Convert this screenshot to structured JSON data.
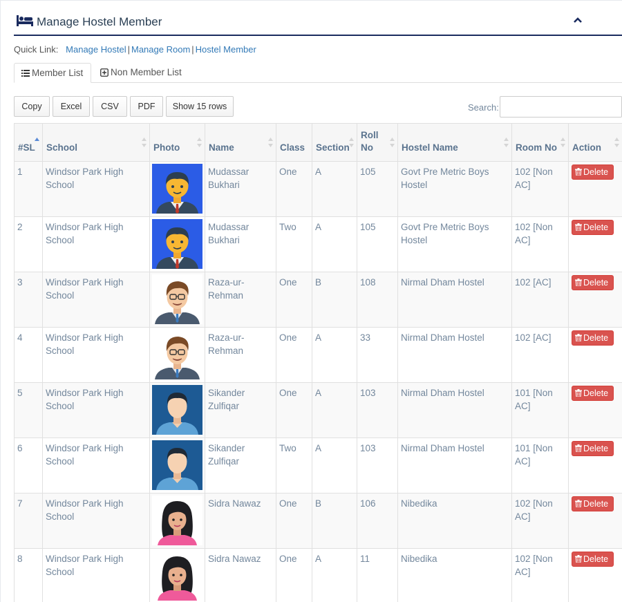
{
  "header": {
    "title": "Manage Hostel Member",
    "icon": "bed-icon",
    "collapse_icon": "chevron-up-icon"
  },
  "quicklinks": {
    "label": "Quick Link:",
    "links": [
      "Manage Hostel",
      "Manage Room",
      "Hostel Member"
    ]
  },
  "tabs": [
    {
      "label": "Member List",
      "icon": "list-icon",
      "active": true
    },
    {
      "label": "Non Member List",
      "icon": "plus-square-icon",
      "active": false
    }
  ],
  "toolbar": {
    "buttons": [
      "Copy",
      "Excel",
      "CSV",
      "PDF",
      "Show 15 rows"
    ]
  },
  "search": {
    "label": "Search:",
    "value": ""
  },
  "table": {
    "columns": [
      "#SL",
      "School",
      "Photo",
      "Name",
      "Class",
      "Section",
      "Roll No",
      "Hostel Name",
      "Room No",
      "Action"
    ],
    "rows": [
      {
        "sl": "1",
        "school": "Windsor Park High School",
        "avatar": "male-suit-blue-bg",
        "name": "Mudassar Bukhari",
        "class": "One",
        "section": "A",
        "roll": "105",
        "hostel": "Govt Pre Metric Boys Hostel",
        "room": "102 [Non AC]",
        "action": "Delete"
      },
      {
        "sl": "2",
        "school": "Windsor Park High School",
        "avatar": "male-suit-blue-bg",
        "name": "Mudassar Bukhari",
        "class": "Two",
        "section": "A",
        "roll": "105",
        "hostel": "Govt Pre Metric Boys Hostel",
        "room": "102 [Non AC]",
        "action": "Delete"
      },
      {
        "sl": "3",
        "school": "Windsor Park High School",
        "avatar": "male-glasses",
        "name": "Raza-ur-Rehman",
        "class": "One",
        "section": "B",
        "roll": "108",
        "hostel": "Nirmal Dham Hostel",
        "room": "102 [AC]",
        "action": "Delete"
      },
      {
        "sl": "4",
        "school": "Windsor Park High School",
        "avatar": "male-glasses",
        "name": "Raza-ur-Rehman",
        "class": "One",
        "section": "A",
        "roll": "33",
        "hostel": "Nirmal Dham Hostel",
        "room": "102 [AC]",
        "action": "Delete"
      },
      {
        "sl": "5",
        "school": "Windsor Park High School",
        "avatar": "male-plain-blue-bg",
        "name": "Sikander Zulfiqar",
        "class": "One",
        "section": "A",
        "roll": "103",
        "hostel": "Nirmal Dham Hostel",
        "room": "101 [Non AC]",
        "action": "Delete"
      },
      {
        "sl": "6",
        "school": "Windsor Park High School",
        "avatar": "male-plain-blue-bg",
        "name": "Sikander Zulfiqar",
        "class": "Two",
        "section": "A",
        "roll": "103",
        "hostel": "Nirmal Dham Hostel",
        "room": "101 [Non AC]",
        "action": "Delete"
      },
      {
        "sl": "7",
        "school": "Windsor Park High School",
        "avatar": "female",
        "name": "Sidra Nawaz",
        "class": "One",
        "section": "B",
        "roll": "106",
        "hostel": "Nibedika",
        "room": "102 [Non AC]",
        "action": "Delete"
      },
      {
        "sl": "8",
        "school": "Windsor Park High School",
        "avatar": "female",
        "name": "Sidra Nawaz",
        "class": "One",
        "section": "A",
        "roll": "11",
        "hostel": "Nibedika",
        "room": "102 [Non AC]",
        "action": "Delete"
      }
    ]
  },
  "colors": {
    "accent": "#1a2b5f",
    "link": "#337ab7",
    "danger": "#d9534f"
  }
}
